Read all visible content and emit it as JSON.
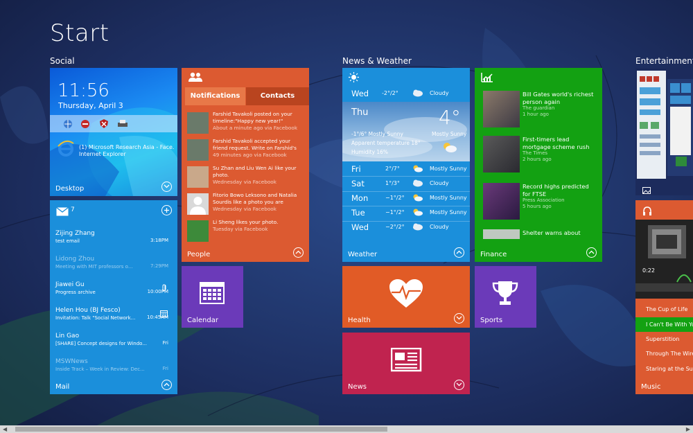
{
  "start": {
    "title": "Start"
  },
  "groups": {
    "social": "Social",
    "news_weather": "News & Weather",
    "entertainment": "Entertainment"
  },
  "desktop": {
    "time": "11:56",
    "date": "Thursday, April 3",
    "ie_line1": "(1) Microsoft Research Asia - Face...",
    "ie_line2": "Internet Explorer",
    "label": "Desktop"
  },
  "mail": {
    "count": "7",
    "label": "Mail",
    "items": [
      {
        "from": "Zijing Zhang",
        "subject": "test email",
        "time": "3:18PM"
      },
      {
        "from": "Lidong Zhou",
        "subject": "Meeting with MIT professors o...",
        "time": "7:29PM"
      },
      {
        "from": "Jiawei Gu",
        "subject": "Progress archive",
        "time": "10:00PM"
      },
      {
        "from": "Helen Hou (BJ Fesco)",
        "subject": "Invitation: Talk \"Social Network...",
        "time": "10:45AM"
      },
      {
        "from": "Lin Gao",
        "subject": "[SHARE] Concept designs for Windo...",
        "time": "Fri"
      },
      {
        "from": "MSWNews",
        "subject": "Inside Track – Week in Review: Dec...",
        "time": "Fri"
      }
    ]
  },
  "people": {
    "label": "People",
    "tab_notifications": "Notifications",
    "tab_contacts": "Contacts",
    "items": [
      {
        "text": "Farshid Tavakoli posted on your timeline:\"Happy new year!\"",
        "sub": "About a minute ago via Facebook"
      },
      {
        "text": "Farshid Tavakoli accepted your friend request. Write on Farshid's",
        "sub": "49 minutes ago via Facebook"
      },
      {
        "text": "Su Zhan and Liu Wen Ai like your photo.",
        "sub": "Wednesday via Facebook"
      },
      {
        "text": "Fitorio Bowo Leksono and Natalia Sourdis like a photo you are",
        "sub": "Wednesday via Facebook"
      },
      {
        "text": "Li Sheng likes your photo.",
        "sub": "Tuesday via Facebook"
      }
    ]
  },
  "calendar": {
    "label": "Calendar"
  },
  "weather": {
    "label": "Weather",
    "top": {
      "day": "Wed",
      "temp": "-2°/2°",
      "cond": "Cloudy"
    },
    "today": {
      "day": "Thu",
      "temp": "4°",
      "cond": "Mostly Sunny",
      "range": "-1°/6° Mostly Sunny",
      "apparent": "Apparent temperature 18°",
      "humidity": "Humidity 16%"
    },
    "forecast": [
      {
        "day": "Fri",
        "temp": "2°/7°",
        "cond": "Mostly Sunny"
      },
      {
        "day": "Sat",
        "temp": "1°/3°",
        "cond": "Cloudy"
      },
      {
        "day": "Mon",
        "temp": "−1°/2°",
        "cond": "Mostly Sunny"
      },
      {
        "day": "Tue",
        "temp": "−1°/2°",
        "cond": "Mostly Sunny"
      },
      {
        "day": "Wed",
        "temp": "−2°/2°",
        "cond": "Cloudy"
      }
    ]
  },
  "finance": {
    "label": "Finance",
    "items": [
      {
        "headline": "Bill Gates world's richest person again",
        "source": "The guardian",
        "time": "1 hour ago"
      },
      {
        "headline": "First-timers lead mortgage scheme rush",
        "source": "The Times",
        "time": "2 hours ago"
      },
      {
        "headline": "Record highs predicted for FTSE",
        "source": "Press Association",
        "time": "5 hours ago"
      },
      {
        "headline": "Shelter warns about",
        "source": "",
        "time": ""
      }
    ]
  },
  "health": {
    "label": "Health"
  },
  "news": {
    "label": "News"
  },
  "sports": {
    "label": "Sports"
  },
  "music": {
    "label": "Music",
    "progress": "0:22",
    "songs": [
      "The Cup of Life",
      "I Can't Be With You",
      "Superstition",
      "Through The Wire",
      "Staring at the Sun"
    ]
  },
  "colors": {
    "accent_blue": "#1b8fdb",
    "orange": "#dc5a31",
    "green": "#13a112",
    "purple": "#6b3ab9",
    "crimson": "#c0234f"
  }
}
